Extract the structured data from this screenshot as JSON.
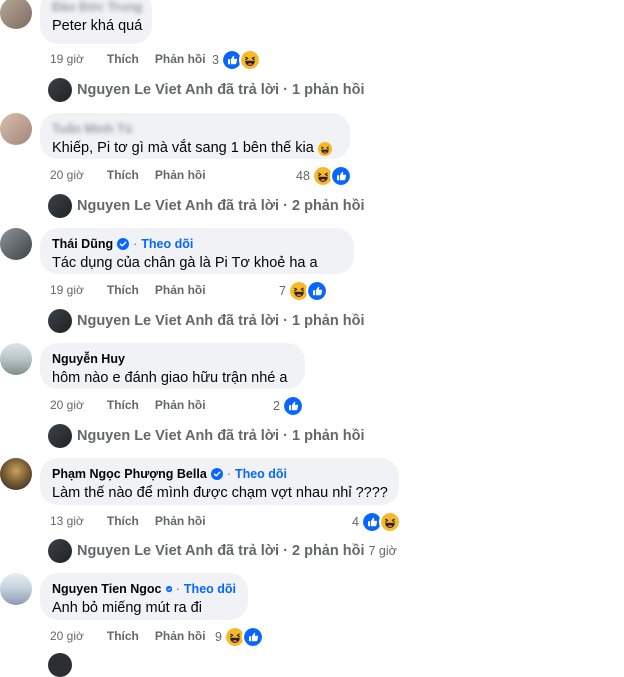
{
  "comments": [
    {
      "author": "Đào Đức Trung",
      "text": "Peter khá quá",
      "time": "19 giờ",
      "like_label": "Thích",
      "reply_label": "Phản hồi",
      "reaction_count": "3",
      "reactions": [
        "like-icon",
        "haha-icon"
      ],
      "reply_summary": {
        "name": "Nguyen Le Viet Anh",
        "action": "đã trả lời",
        "sep": "·",
        "count": "1 phản hồi"
      }
    },
    {
      "author": "Tuấn Minh Tú",
      "text": "Khiếp, Pi tơ gì mà vắt sang 1 bên thế kia",
      "time": "20 giờ",
      "like_label": "Thích",
      "reply_label": "Phản hồi",
      "reaction_count": "48",
      "reactions": [
        "haha-icon",
        "like-icon"
      ],
      "reply_summary": {
        "name": "Nguyen Le Viet Anh",
        "action": "đã trả lời",
        "sep": "·",
        "count": "2 phản hồi"
      }
    },
    {
      "author": "Thái Dũng",
      "follow": "Theo dõi",
      "text": "Tác dụng của chân gà là Pi Tơ khoẻ ha a",
      "time": "19 giờ",
      "like_label": "Thích",
      "reply_label": "Phản hồi",
      "reaction_count": "7",
      "reactions": [
        "haha-icon",
        "like-icon"
      ],
      "reply_summary": {
        "name": "Nguyen Le Viet Anh",
        "action": "đã trả lời",
        "sep": "·",
        "count": "1 phản hồi"
      }
    },
    {
      "author": "Nguyễn Huy",
      "text": "hôm nào e đánh giao hữu trận nhé a",
      "time": "20 giờ",
      "like_label": "Thích",
      "reply_label": "Phản hồi",
      "reaction_count": "2",
      "reactions": [
        "like-icon"
      ],
      "reply_summary": {
        "name": "Nguyen Le Viet Anh",
        "action": "đã trả lời",
        "sep": "·",
        "count": "1 phản hồi"
      }
    },
    {
      "author": "Phạm Ngọc Phượng Bella",
      "follow": "Theo dõi",
      "text": "Làm thế nào để mình được chạm vợt nhau nhỉ ????",
      "time": "13 giờ",
      "like_label": "Thích",
      "reply_label": "Phản hồi",
      "reaction_count": "4",
      "reactions": [
        "like-icon",
        "haha-icon"
      ],
      "reply_summary": {
        "name": "Nguyen Le Viet Anh",
        "action": "đã trả lời",
        "sep": "·",
        "count": "2 phản hồi",
        "time": "7 giờ"
      }
    },
    {
      "author": "Nguyen Tien Ngoc",
      "follow": "Theo dõi",
      "text": "Anh bỏ miếng mút ra đi",
      "time": "20 giờ",
      "like_label": "Thích",
      "reply_label": "Phản hồi",
      "reaction_count": "9",
      "reactions": [
        "haha-icon",
        "like-icon"
      ]
    }
  ],
  "colors": {
    "like_blue": "#0866ff",
    "haha_yellow": "#f7b928",
    "bubble_bg": "#f0f2f5",
    "meta_gray": "#65676b"
  }
}
